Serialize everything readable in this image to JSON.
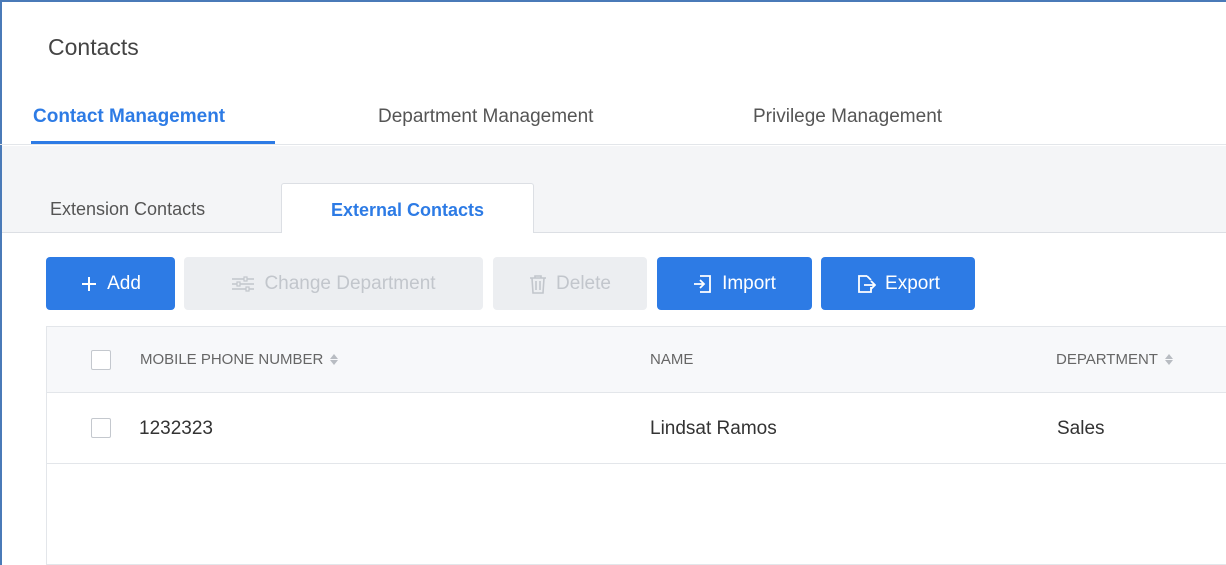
{
  "page": {
    "title": "Contacts"
  },
  "main_tabs": [
    {
      "label": "Contact Management",
      "active": true
    },
    {
      "label": "Department Management",
      "active": false
    },
    {
      "label": "Privilege Management",
      "active": false
    }
  ],
  "sub_tabs": [
    {
      "label": "Extension Contacts",
      "active": false
    },
    {
      "label": "External Contacts",
      "active": true
    }
  ],
  "toolbar": {
    "add_label": "Add",
    "change_department_label": "Change Department",
    "delete_label": "Delete",
    "import_label": "Import",
    "export_label": "Export"
  },
  "table": {
    "columns": [
      {
        "label": "MOBILE PHONE NUMBER",
        "sortable": true
      },
      {
        "label": "NAME",
        "sortable": false
      },
      {
        "label": "DEPARTMENT",
        "sortable": true
      }
    ],
    "rows": [
      {
        "mobile_phone_number": "1232323",
        "name": "Lindsat Ramos",
        "department": "Sales"
      }
    ]
  },
  "colors": {
    "accent": "#2d7be5",
    "frame": "#4a7ab8",
    "disabled_bg": "#eceef1"
  },
  "icons": {
    "add": "plus-icon",
    "change_department": "sliders-icon",
    "delete": "trash-icon",
    "import": "import-icon",
    "export": "export-icon",
    "sort": "sort-icon"
  }
}
